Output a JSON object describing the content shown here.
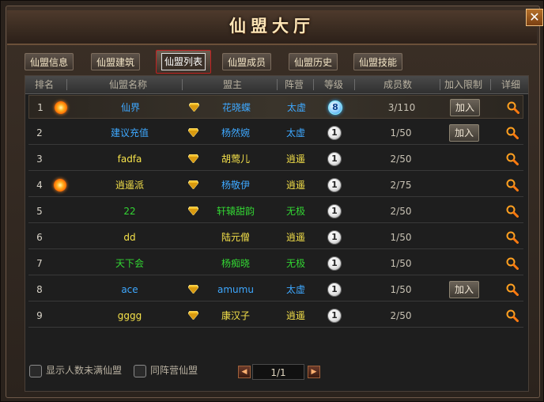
{
  "window": {
    "title": "仙盟大厅",
    "close_label": "✕"
  },
  "tabs": [
    {
      "label": "仙盟信息",
      "active": false
    },
    {
      "label": "仙盟建筑",
      "active": false
    },
    {
      "label": "仙盟列表",
      "active": true
    },
    {
      "label": "仙盟成员",
      "active": false
    },
    {
      "label": "仙盟历史",
      "active": false
    },
    {
      "label": "仙盟技能",
      "active": false
    }
  ],
  "table": {
    "headers": {
      "rank": "排名",
      "name": "仙盟名称",
      "leader": "盟主",
      "camp": "阵营",
      "level": "等级",
      "members": "成员数",
      "join_limit": "加入限制",
      "detail": "详细"
    },
    "rows": [
      {
        "rank": "1",
        "name": "仙界",
        "leader": "花晓蝶",
        "camp": "太虚",
        "level": "8",
        "members": "3/110",
        "join": "加入"
      },
      {
        "rank": "2",
        "name": "建议充值",
        "leader": "杨然婉",
        "camp": "太虚",
        "level": "1",
        "members": "1/50",
        "join": "加入"
      },
      {
        "rank": "3",
        "name": "fadfa",
        "leader": "胡莺儿",
        "camp": "逍遥",
        "level": "1",
        "members": "2/50",
        "join": ""
      },
      {
        "rank": "4",
        "name": "逍遥派",
        "leader": "杨敬伊",
        "camp": "逍遥",
        "level": "1",
        "members": "2/75",
        "join": ""
      },
      {
        "rank": "5",
        "name": "22",
        "leader": "轩辕甜韵",
        "camp": "无极",
        "level": "1",
        "members": "2/50",
        "join": ""
      },
      {
        "rank": "6",
        "name": "dd",
        "leader": "陆元僧",
        "camp": "逍遥",
        "level": "1",
        "members": "1/50",
        "join": ""
      },
      {
        "rank": "7",
        "name": "天下会",
        "leader": "杨痴晓",
        "camp": "无极",
        "level": "1",
        "members": "1/50",
        "join": ""
      },
      {
        "rank": "8",
        "name": "ace",
        "leader": "amumu",
        "camp": "太虚",
        "level": "1",
        "members": "1/50",
        "join": "加入"
      },
      {
        "rank": "9",
        "name": "gggg",
        "leader": "康汉子",
        "camp": "逍遥",
        "level": "1",
        "members": "2/50",
        "join": ""
      }
    ]
  },
  "footer": {
    "show_not_full": "显示人数未满仙盟",
    "same_camp": "同阵营仙盟",
    "page": "1/1",
    "prev_label": "◀",
    "next_label": "▶"
  },
  "colors": {
    "camp_taixu": "#3ea8ff",
    "camp_xiaoyao": "#f6e24a",
    "camp_wuji": "#33d633",
    "name_blue": "#3ea8ff",
    "name_yellow": "#f6e24a",
    "name_green": "#33d633"
  }
}
